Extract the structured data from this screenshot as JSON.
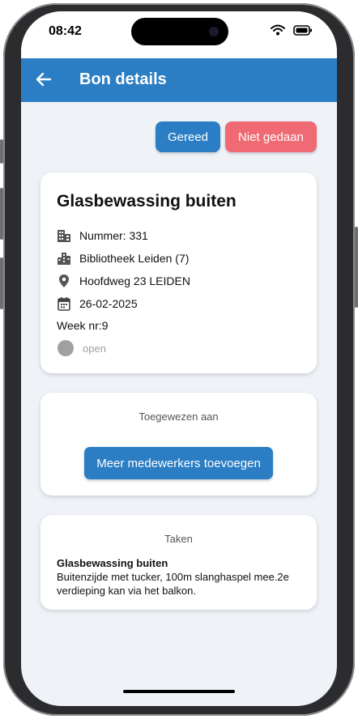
{
  "status_bar": {
    "time": "08:42"
  },
  "appbar": {
    "title": "Bon details"
  },
  "actions": {
    "done_label": "Gereed",
    "not_done_label": "Niet gedaan"
  },
  "detail": {
    "title": "Glasbewassing buiten",
    "number": "Nummer: 331",
    "location": "Bibliotheek Leiden (7)",
    "address": "Hoofdweg 23 LEIDEN",
    "date": "26-02-2025",
    "week": "Week nr:9",
    "status": "open"
  },
  "assigned": {
    "heading": "Toegewezen aan",
    "add_button": "Meer medewerkers toevoegen"
  },
  "tasks": {
    "heading": "Taken",
    "items": [
      {
        "name": "Glasbewassing buiten",
        "description": "Buitenzijde met tucker, 100m slanghaspel mee.2e verdieping kan via het balkon."
      }
    ]
  },
  "colors": {
    "primary": "#2b7ec4",
    "danger": "#f06a73",
    "background": "#eff3f8",
    "status_grey": "#a0a0a0"
  }
}
